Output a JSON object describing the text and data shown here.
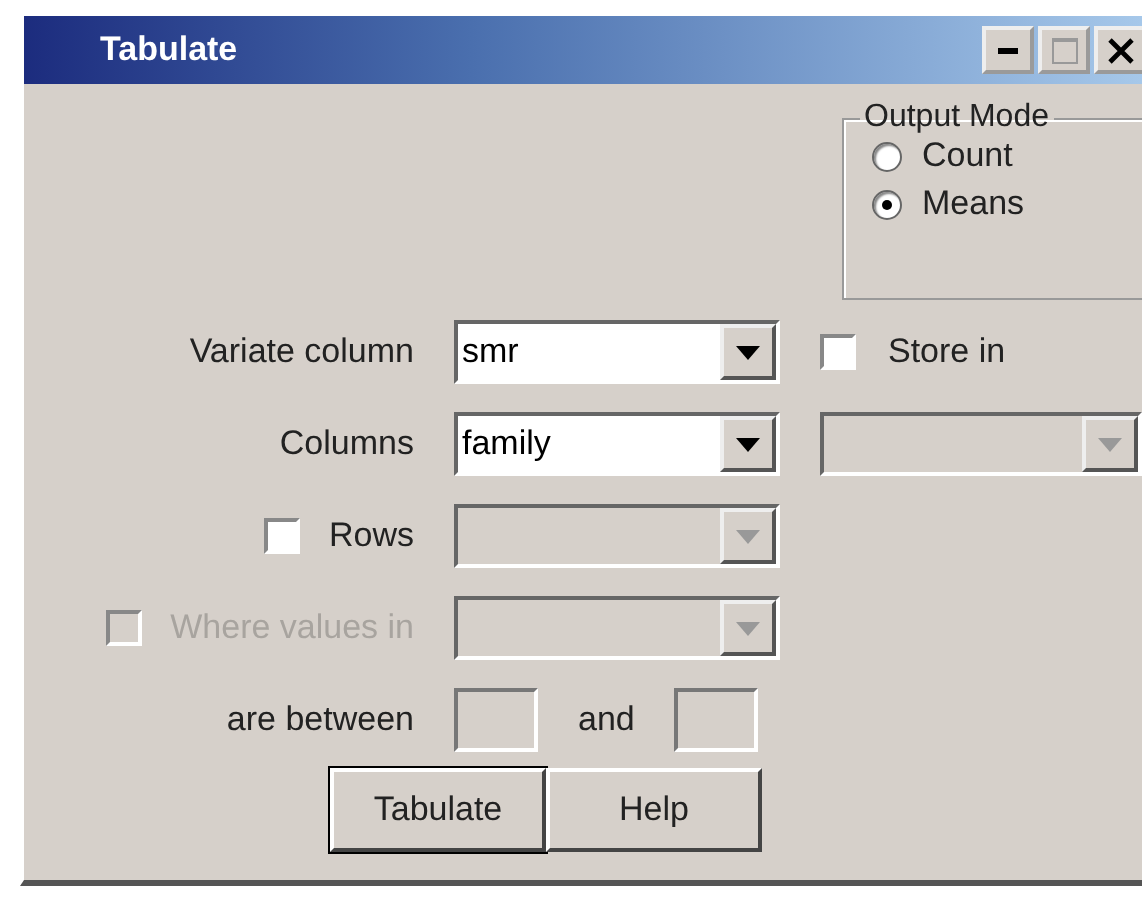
{
  "window": {
    "title": "Tabulate"
  },
  "output_mode": {
    "title": "Output Mode",
    "options": [
      {
        "label": "Count",
        "selected": false
      },
      {
        "label": "Means",
        "selected": true
      }
    ]
  },
  "fields": [
    {
      "kind": "combo",
      "label": "Variate column",
      "value": "smr",
      "disabled": false
    },
    {
      "kind": "combo",
      "label": "Columns",
      "value": "family",
      "disabled": false
    },
    {
      "kind": "check-combo",
      "label": "Rows",
      "checked": false,
      "disabled": false
    },
    {
      "kind": "check-combo",
      "label": "Where values in",
      "checked": false,
      "disabled": true
    },
    {
      "kind": "range",
      "label": "are between",
      "and_label": "and"
    }
  ],
  "store": {
    "label": "Store in",
    "checked": false,
    "combo_disabled": true
  },
  "buttons": [
    {
      "label": "Tabulate",
      "default": true
    },
    {
      "label": "Help",
      "default": false
    }
  ]
}
